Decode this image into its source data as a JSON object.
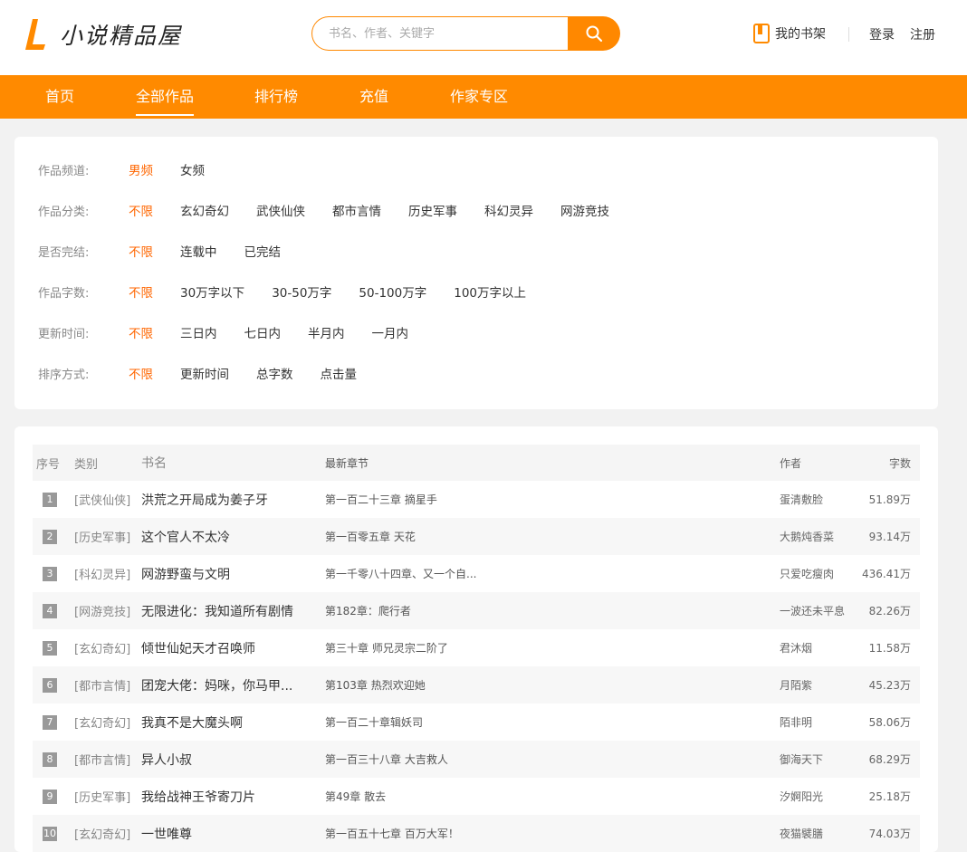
{
  "brand": {
    "name": "小说精品屋",
    "accent": "#ff8a00"
  },
  "search": {
    "placeholder": "书名、作者、关键字"
  },
  "header": {
    "shelf_label": "我的书架",
    "login_label": "登录",
    "register_label": "注册"
  },
  "nav": {
    "items": [
      "首页",
      "全部作品",
      "排行榜",
      "充值",
      "作家专区"
    ],
    "active": "全部作品"
  },
  "filters": {
    "channel": {
      "label": "作品频道:",
      "options": [
        "男频",
        "女频"
      ]
    },
    "category": {
      "label": "作品分类:",
      "options": [
        "不限",
        "玄幻奇幻",
        "武侠仙侠",
        "都市言情",
        "历史军事",
        "科幻灵异",
        "网游竞技"
      ]
    },
    "status": {
      "label": "是否完结:",
      "options": [
        "不限",
        "连载中",
        "已完结"
      ]
    },
    "words": {
      "label": "作品字数:",
      "options": [
        "不限",
        "30万字以下",
        "30-50万字",
        "50-100万字",
        "100万字以上"
      ]
    },
    "update": {
      "label": "更新时间:",
      "options": [
        "不限",
        "三日内",
        "七日内",
        "半月内",
        "一月内"
      ]
    },
    "sort": {
      "label": "排序方式:",
      "options": [
        "不限",
        "更新时间",
        "总字数",
        "点击量"
      ]
    }
  },
  "table": {
    "headers": {
      "no": "序号",
      "category": "类别",
      "name": "书名",
      "chapter": "最新章节",
      "author": "作者",
      "words": "字数"
    },
    "rows": [
      {
        "no": "1",
        "category": "[武侠仙侠]",
        "name": "洪荒之开局成为姜子牙",
        "chapter": "第一百二十三章 摘星手",
        "author": "蛋清敷脸",
        "words": "51.89万"
      },
      {
        "no": "2",
        "category": "[历史军事]",
        "name": "这个官人不太冷",
        "chapter": "第一百零五章 天花",
        "author": "大鹅炖香菜",
        "words": "93.14万"
      },
      {
        "no": "3",
        "category": "[科幻灵异]",
        "name": "网游野蛮与文明",
        "chapter": "第一千零八十四章、又一个自...",
        "author": "只爱吃瘦肉",
        "words": "436.41万"
      },
      {
        "no": "4",
        "category": "[网游竞技]",
        "name": "无限进化：我知道所有剧情",
        "chapter": "第182章：爬行者",
        "author": "一波还未平息",
        "words": "82.26万"
      },
      {
        "no": "5",
        "category": "[玄幻奇幻]",
        "name": "倾世仙妃天才召唤师",
        "chapter": "第三十章 师兄灵宗二阶了",
        "author": "君沐烟",
        "words": "11.58万"
      },
      {
        "no": "6",
        "category": "[都市言情]",
        "name": "团宠大佬：妈咪，你马甲...",
        "chapter": "第103章 热烈欢迎她",
        "author": "月陌紫",
        "words": "45.23万"
      },
      {
        "no": "7",
        "category": "[玄幻奇幻]",
        "name": "我真不是大魔头啊",
        "chapter": "第一百二十章辑妖司",
        "author": "陌非明",
        "words": "58.06万"
      },
      {
        "no": "8",
        "category": "[都市言情]",
        "name": "异人小叔",
        "chapter": "第一百三十八章 大吉救人",
        "author": "御海天下",
        "words": "68.29万"
      },
      {
        "no": "9",
        "category": "[历史军事]",
        "name": "我给战神王爷寄刀片",
        "chapter": "第49章 散去",
        "author": "汐婀阳光",
        "words": "25.18万"
      },
      {
        "no": "10",
        "category": "[玄幻奇幻]",
        "name": "一世唯尊",
        "chapter": "第一百五十七章 百万大军！",
        "author": "夜猫襞膳",
        "words": "74.03万"
      }
    ]
  }
}
